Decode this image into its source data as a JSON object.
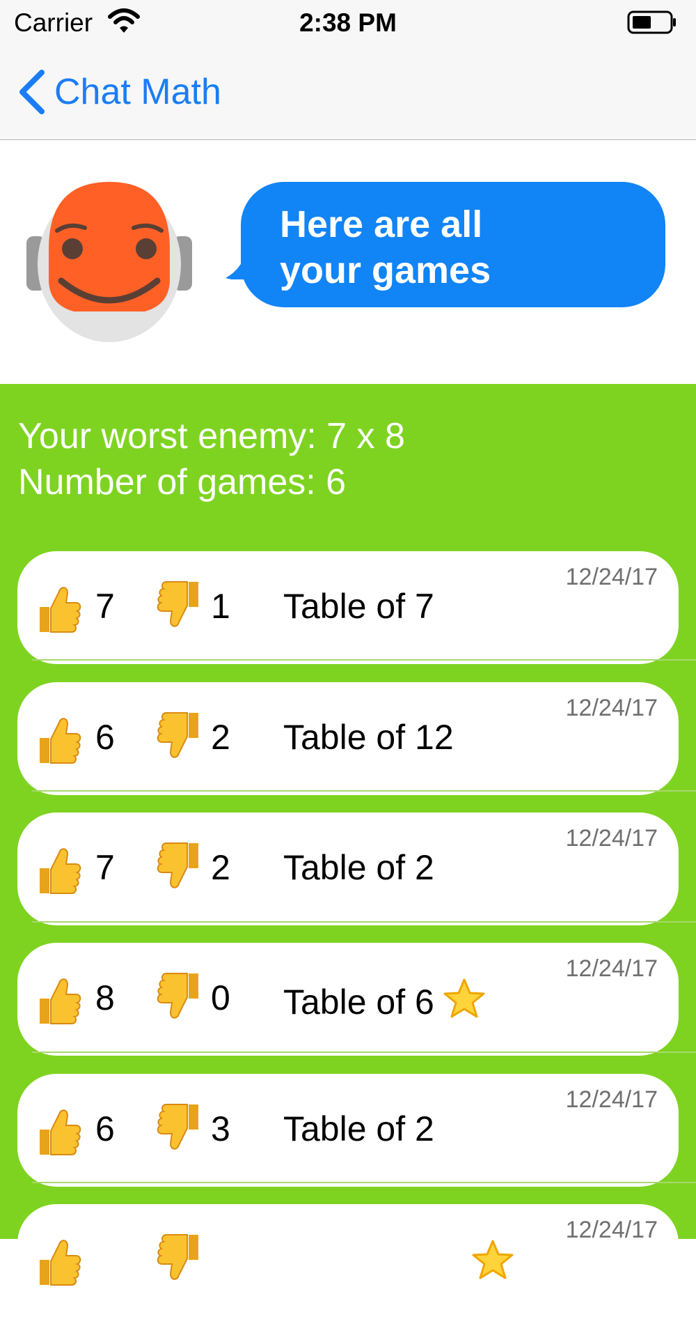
{
  "status_bar": {
    "carrier": "Carrier",
    "time": "2:38 PM"
  },
  "nav": {
    "back_label": "Chat Math"
  },
  "chat": {
    "message_line1": "Here are all",
    "message_line2": "your games"
  },
  "summary": {
    "worst_enemy": "Your worst enemy: 7 x 8",
    "game_count": "Number of games: 6"
  },
  "games": [
    {
      "right": "7",
      "wrong": "1",
      "title": "Table of 7",
      "date": "12/24/17",
      "star": false
    },
    {
      "right": "6",
      "wrong": "2",
      "title": "Table of 12",
      "date": "12/24/17",
      "star": false
    },
    {
      "right": "7",
      "wrong": "2",
      "title": "Table of 2",
      "date": "12/24/17",
      "star": false
    },
    {
      "right": "8",
      "wrong": "0",
      "title": "Table of 6",
      "date": "12/24/17",
      "star": true
    },
    {
      "right": "6",
      "wrong": "3",
      "title": "Table of 2",
      "date": "12/24/17",
      "star": false
    },
    {
      "right": "",
      "wrong": "",
      "title": "",
      "date": "12/24/17",
      "star": true
    }
  ],
  "colors": {
    "accent_blue": "#1a7df5",
    "bubble_blue": "#1184f6",
    "panel_green": "#7ed321",
    "robot_orange": "#ff6026"
  },
  "icons": [
    "wifi-icon",
    "battery-icon",
    "back-chevron-icon",
    "robot-avatar-icon",
    "thumbs-up-icon",
    "thumbs-down-icon",
    "star-icon"
  ]
}
